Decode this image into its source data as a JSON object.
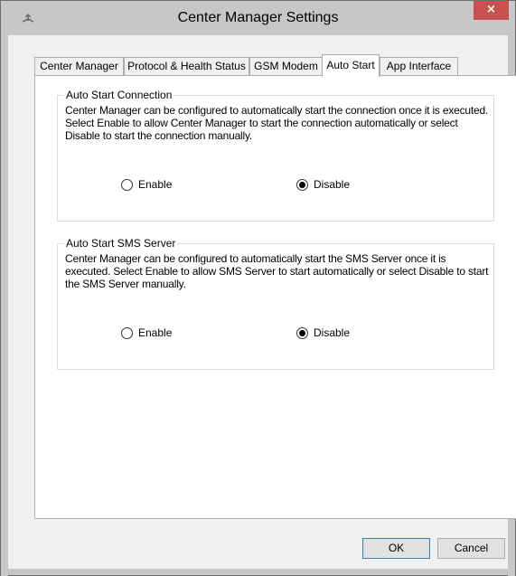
{
  "window": {
    "title": "Center Manager Settings",
    "close_glyph": "×",
    "icon": "app-icon",
    "colors": {
      "titlebar": "#c7c7c7",
      "close": "#c75050"
    }
  },
  "tabs": [
    {
      "label": "Center Manager",
      "active": false
    },
    {
      "label": "Protocol & Health Status",
      "active": false
    },
    {
      "label": "GSM Modem",
      "active": false
    },
    {
      "label": "Auto Start",
      "active": true
    },
    {
      "label": "App Interface",
      "active": false
    }
  ],
  "auto_start_connection": {
    "legend": "Auto Start Connection",
    "description": "Center Manager can be configured to automatically start the connection once it is executed. Select Enable to allow Center Manager to start the connection automatically or select Disable to start the connection manually.",
    "enable_label": "Enable",
    "disable_label": "Disable",
    "selected": "Disable"
  },
  "auto_start_sms": {
    "legend": "Auto Start SMS Server",
    "description": "Center Manager can be configured to automatically start the SMS Server once it is executed. Select Enable to allow SMS Server to start automatically or select Disable to start the SMS Server manually.",
    "enable_label": "Enable",
    "disable_label": "Disable",
    "selected": "Disable"
  },
  "buttons": {
    "ok_label": "OK",
    "cancel_label": "Cancel"
  }
}
